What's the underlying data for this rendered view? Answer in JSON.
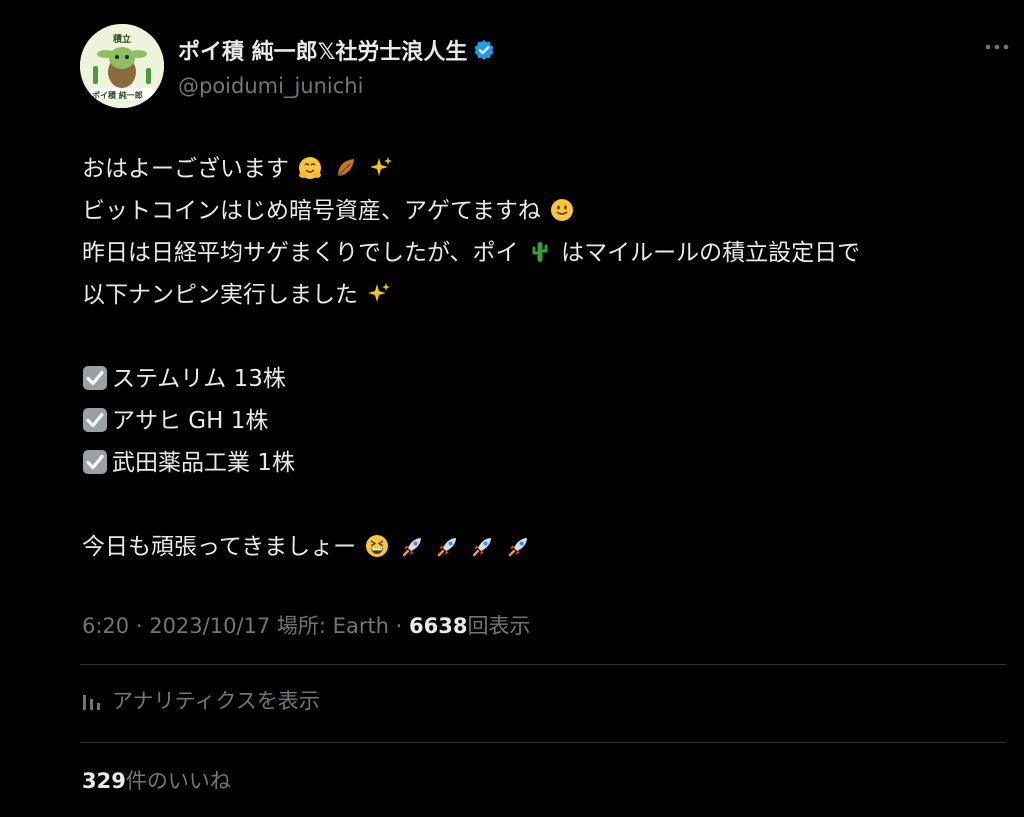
{
  "author": {
    "display_name": "ポイ積 純一郎𝕏社労士浪人生",
    "handle": "@poidumi_junichi",
    "avatar_badge_top": "積立",
    "avatar_badge_bottom": "ポイ積 純一郎"
  },
  "post": {
    "lines": [
      "おはよーございます",
      "ビットコインはじめ暗号資産、アゲてますね",
      "昨日は日経平均サゲまくりでしたが、ポイ",
      "はマイルールの積立設定日で",
      "以下ナンピン実行しました",
      "ステムリム 13株",
      "アサヒ GH 1株",
      "武田薬品工業 1株",
      "今日も頑張ってきましょー"
    ]
  },
  "meta": {
    "time": "6:20",
    "sep1": " · ",
    "date": "2023/10/17",
    "location": " 場所: Earth",
    "sep2": " · ",
    "views": "6638",
    "views_label": "回表示"
  },
  "analytics": {
    "label": "アナリティクスを表示"
  },
  "likes": {
    "count": "329",
    "label": "件のいいね"
  },
  "colors": {
    "background": "#000000",
    "text": "#e7e9ea",
    "muted": "#71767b",
    "verified": "#1d9bf0",
    "divider": "#2f3336"
  },
  "icons": [
    "avatar-icon",
    "verified-badge-icon",
    "more-icon",
    "hugging-emoji-icon",
    "leaf-emoji-icon",
    "sparkles-emoji-icon",
    "smile-emoji-icon",
    "cactus-emoji-icon",
    "checkbox-icon",
    "grin-emoji-icon",
    "rocket-emoji-icon",
    "analytics-icon"
  ]
}
